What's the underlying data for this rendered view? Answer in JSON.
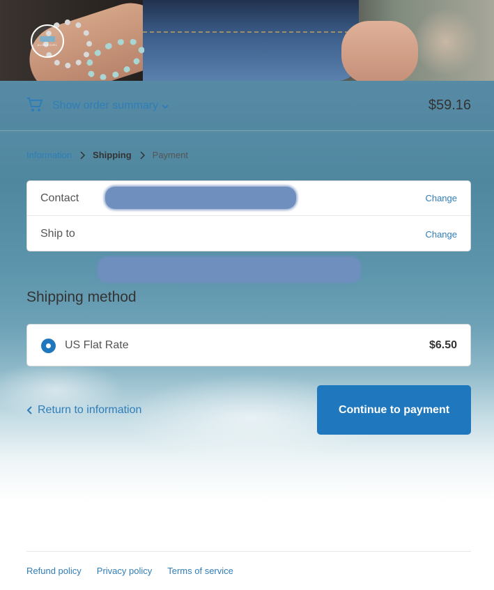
{
  "header": {
    "logo_text": "ALOHA GIRL"
  },
  "summary": {
    "toggle_label": "Show order summary",
    "total": "$59.16"
  },
  "breadcrumb": {
    "items": [
      "Information",
      "Shipping",
      "Payment"
    ]
  },
  "review": {
    "contact_label": "Contact",
    "ship_to_label": "Ship to",
    "change_label": "Change"
  },
  "shipping": {
    "title": "Shipping method",
    "rate_name": "US Flat Rate",
    "rate_price": "$6.50",
    "selected": true
  },
  "actions": {
    "return_label": "Return to information",
    "continue_label": "Continue to payment"
  },
  "footer": {
    "links": [
      "Refund policy",
      "Privacy policy",
      "Terms of service"
    ]
  },
  "colors": {
    "accent": "#1f77bd",
    "link": "#2f7db8"
  },
  "icons": [
    "cart-icon",
    "chevron-down-icon",
    "chevron-right-icon",
    "chevron-left-icon"
  ]
}
